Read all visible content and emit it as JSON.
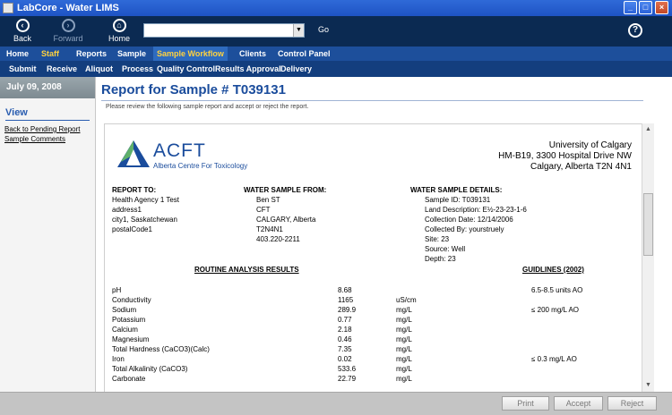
{
  "window": {
    "title": "LabCore - Water LIMS"
  },
  "toolbar": {
    "back_label": "Back",
    "forward_label": "Forward",
    "home_label": "Home",
    "go_label": "Go",
    "url_value": "",
    "help_icon": "?"
  },
  "nav": {
    "main": [
      "Home",
      "Staff",
      "Reports",
      "Sample",
      "Sample Workflow",
      "Clients",
      "Control Panel"
    ],
    "active": "Sample Workflow",
    "sub": [
      "Submit",
      "Receive",
      "Aliquot",
      "Process",
      "Quality Control",
      "Results Approval",
      "Delivery"
    ]
  },
  "sidebar": {
    "date": "July 09, 2008",
    "view_header": "View",
    "links": [
      "Back to Pending Report",
      "Sample Comments"
    ]
  },
  "page": {
    "title": "Report for Sample # T039131",
    "instruction": "Please review the following sample report and accept or reject the report."
  },
  "report": {
    "logo_brand": "ACFT",
    "logo_tagline": "Alberta Centre For Toxicology",
    "address_lines": [
      "University of Calgary",
      "HM-B19, 3300 Hospital Drive NW",
      "Calgary, Alberta T2N 4N1"
    ],
    "report_to": {
      "header": "REPORT TO:",
      "lines": [
        "Health Agency 1 Test",
        "address1",
        "city1,  Saskatchewan",
        "postalCode1"
      ]
    },
    "water_sample_from": {
      "header": "WATER SAMPLE FROM:",
      "lines": [
        "Ben ST",
        "CFT",
        "CALGARY,  Alberta",
        "T2N4N1",
        "403.220-2211"
      ]
    },
    "water_sample_details": {
      "header": "WATER SAMPLE DETAILS:",
      "lines": [
        "Sample ID: T039131",
        "Land Description: E½-23-23-1-6",
        "Collection Date: 12/14/2006",
        "Collected By: yourstruely",
        "Site: 23",
        "Source: Well",
        "Depth: 23"
      ]
    },
    "results_header": "ROUTINE ANALYSIS RESULTS",
    "guidelines_header": "GUIDLINES (2002)",
    "results": [
      {
        "name": "pH",
        "value": "8.68",
        "unit": "",
        "guideline": "6.5-8.5 units AO"
      },
      {
        "name": "Conductivity",
        "value": "1165",
        "unit": "uS/cm",
        "guideline": ""
      },
      {
        "name": "Sodium",
        "value": "289.9",
        "unit": "mg/L",
        "guideline": "≤ 200 mg/L AO"
      },
      {
        "name": "Potassium",
        "value": "0.77",
        "unit": "mg/L",
        "guideline": ""
      },
      {
        "name": "Calcium",
        "value": "2.18",
        "unit": "mg/L",
        "guideline": ""
      },
      {
        "name": "Magnesium",
        "value": "0.46",
        "unit": "mg/L",
        "guideline": ""
      },
      {
        "name": "Total Hardness (CaCO3)(Calc)",
        "value": "7.35",
        "unit": "mg/L",
        "guideline": ""
      },
      {
        "name": "Iron",
        "value": "0.02",
        "unit": "mg/L",
        "guideline": "≤ 0.3 mg/L AO"
      },
      {
        "name": "Total Alkalinity (CaCO3)",
        "value": "533.6",
        "unit": "mg/L",
        "guideline": ""
      },
      {
        "name": "Carbonate",
        "value": "22.79",
        "unit": "mg/L",
        "guideline": ""
      }
    ]
  },
  "buttons": {
    "print": "Print",
    "accept": "Accept",
    "reject": "Reject"
  },
  "colors": {
    "header_blue": "#0b2a52",
    "nav_blue": "#1d4f9b",
    "accent_yellow": "#ffd23f",
    "title_blue": "#1a4c9c"
  }
}
